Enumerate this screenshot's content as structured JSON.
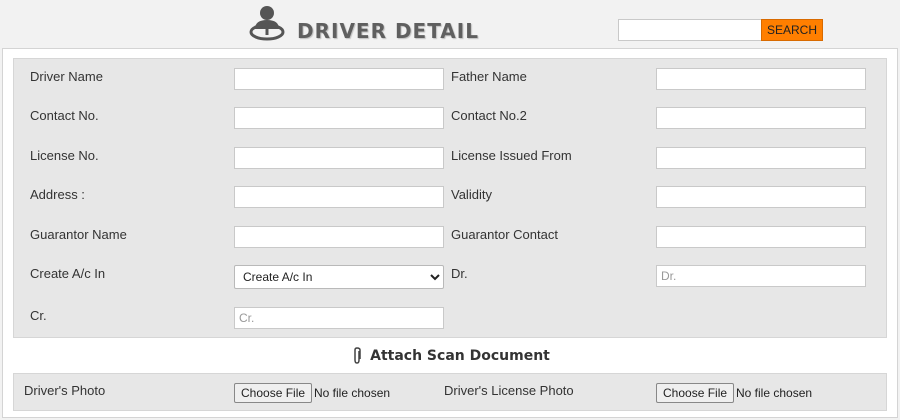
{
  "header": {
    "title": "DRIVER DETAIL",
    "logo_icon": "steering-driver-icon",
    "search_placeholder": "",
    "search_label": "SEARCH",
    "accent_color": "#ff7f00"
  },
  "form": {
    "driver_name_label": "Driver Name",
    "father_name_label": "Father Name",
    "contact_label": "Contact No.",
    "contact2_label": "Contact No.2",
    "license_label": "License No.",
    "license_issued_label": "License Issued From",
    "address_label": "Address :",
    "validity_label": "Validity",
    "guarantor_name_label": "Guarantor Name",
    "guarantor_contact_label": "Guarantor Contact",
    "create_ac_label": "Create A/c In",
    "create_ac_selected": "Create A/c In",
    "dr_label": "Dr.",
    "dr_placeholder": "Dr.",
    "cr_label": "Cr.",
    "cr_placeholder": "Cr."
  },
  "attach": {
    "title": "Attach Scan Document",
    "icon": "paperclip-icon"
  },
  "files": {
    "photo_label": "Driver's Photo",
    "license_photo_label": "Driver's License Photo",
    "choose_label": "Choose File",
    "status": "No file chosen"
  }
}
